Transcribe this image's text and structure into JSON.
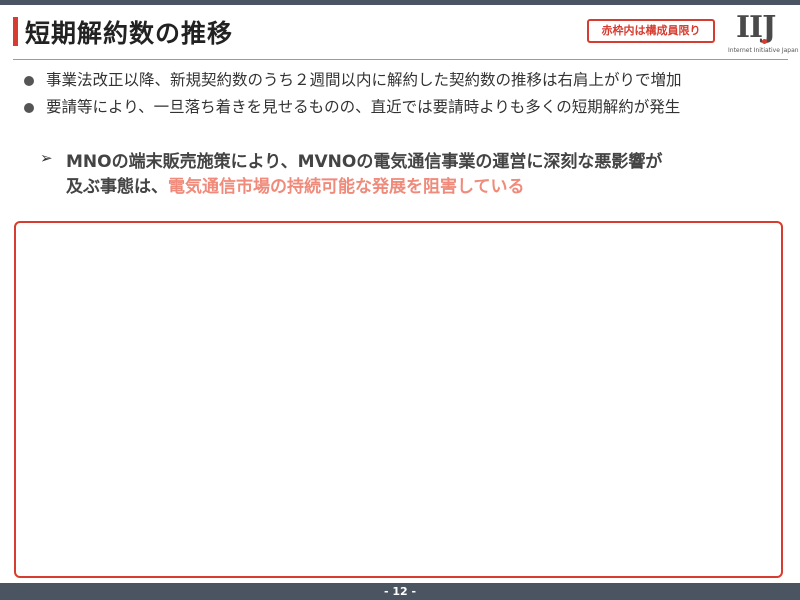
{
  "header": {
    "title": "短期解約数の推移",
    "badge_label": "赤枠内は構成員限り",
    "logo_mark": "IIJ",
    "logo_subtitle": "Internet Initiative Japan"
  },
  "bullets": [
    "事業法改正以降、新規契約数のうち２週間以内に解約した契約数の推移は右肩上がりで増加",
    "要請等により、一旦落ち着きを見せるものの、直近では要請時よりも多くの短期解約が発生"
  ],
  "callout": {
    "arrow": "➢",
    "line1": "MNOの端末販売施策により、MVNOの電気通信事業の運営に深刻な悪影響が",
    "line2_plain": "及ぶ事態は、",
    "line2_highlight": "電気通信市場の持続可能な発展を阻害している"
  },
  "footer": {
    "page_number": "- 12 -"
  },
  "colors": {
    "accent_red": "#d63c2f",
    "highlight_pink": "#f08a7a",
    "bar_slate": "#4a5561"
  }
}
